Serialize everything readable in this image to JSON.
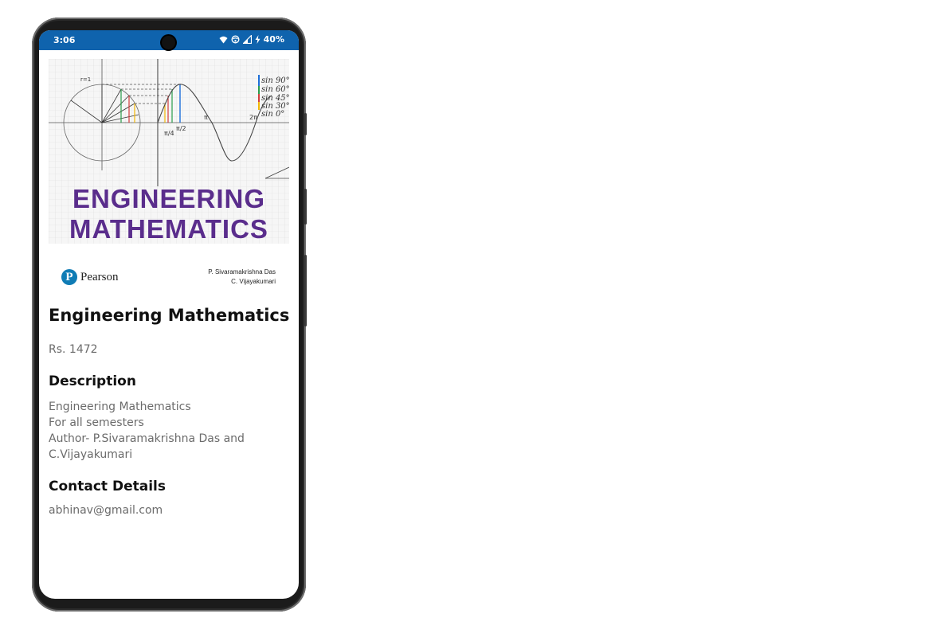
{
  "status_bar": {
    "time": "3:06",
    "battery": "40%",
    "icons": [
      "wifi-icon",
      "hotspot-icon",
      "signal-icon",
      "charging-icon"
    ]
  },
  "cover": {
    "title_line1": "ENGINEERING",
    "title_line2": "MATHEMATICS",
    "trig_labels": [
      "sin 90°",
      "sin 60°",
      "sin 45°",
      "sin 30°",
      "sin 0°"
    ],
    "title_color": "#5a2d8c"
  },
  "publisher": {
    "name": "Pearson",
    "author1": "P. Sivaramakrishna Das",
    "author2": "C. Vijayakumari"
  },
  "product": {
    "title": "Engineering Mathematics",
    "price": "Rs. 1472"
  },
  "description": {
    "heading": "Description",
    "lines": [
      "Engineering Mathematics",
      "For all semesters",
      "Author- P.Sivaramakrishna Das and",
      "C.Vijayakumari"
    ]
  },
  "contact": {
    "heading": "Contact Details",
    "email": "abhinav@gmail.com"
  },
  "colors": {
    "status_bar": "#0f63ad"
  }
}
